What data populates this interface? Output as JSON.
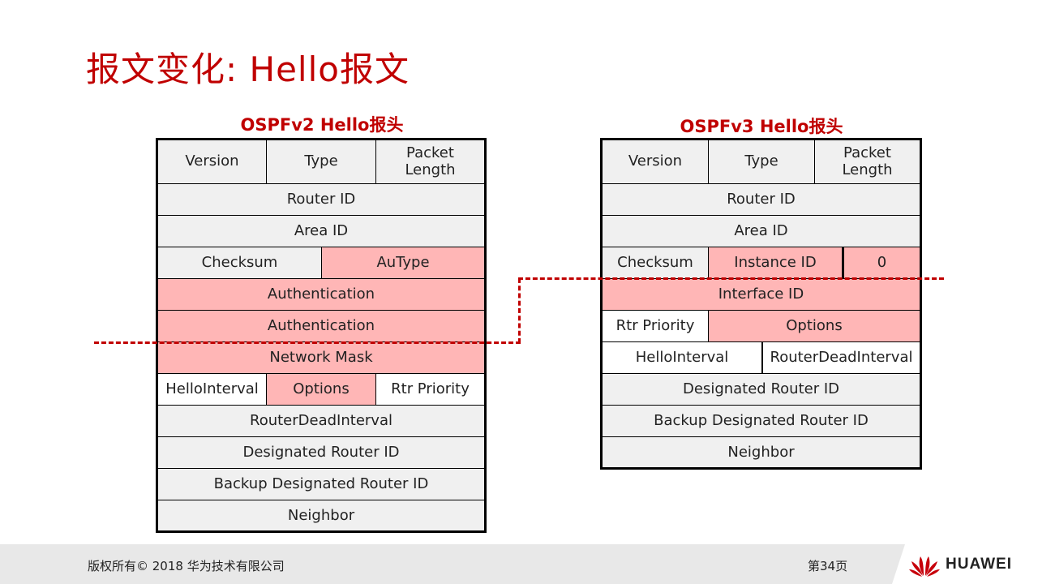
{
  "page": {
    "title": "报文变化: Hello报文"
  },
  "v2": {
    "title": "OSPFv2 Hello报头",
    "version": "Version",
    "type": "Type",
    "packet_length": "Packet\nLength",
    "router_id": "Router ID",
    "area_id": "Area ID",
    "checksum": "Checksum",
    "autype": "AuType",
    "authentication_1": "Authentication",
    "authentication_2": "Authentication",
    "network_mask": "Network Mask",
    "hello_interval": "HelloInterval",
    "options": "Options",
    "rtr_priority": "Rtr Priority",
    "router_dead_interval": "RouterDeadInterval",
    "designated_router_id": "Designated Router ID",
    "backup_designated_router_id": "Backup Designated Router ID",
    "neighbor": "Neighbor"
  },
  "v3": {
    "title": "OSPFv3 Hello报头",
    "version": "Version",
    "type": "Type",
    "packet_length": "Packet\nLength",
    "router_id": "Router ID",
    "area_id": "Area ID",
    "checksum": "Checksum",
    "instance_id": "Instance ID",
    "zero": "0",
    "interface_id": "Interface ID",
    "rtr_priority": "Rtr Priority",
    "options": "Options",
    "hello_interval": "HelloInterval",
    "router_dead_interval": "RouterDeadInterval",
    "designated_router_id": "Designated Router ID",
    "backup_designated_router_id": "Backup Designated Router ID",
    "neighbor": "Neighbor"
  },
  "colors": {
    "title_red": "#c00000",
    "changed_field": "#ffb6b6",
    "unchanged_field": "#f0f0f0",
    "footer_bg": "#e8e8e8"
  },
  "footer": {
    "copyright": "版权所有© 2018 华为技术有限公司",
    "page_number": "第34页",
    "brand": "HUAWEI",
    "logo_icon": "huawei-petal-logo-icon"
  }
}
